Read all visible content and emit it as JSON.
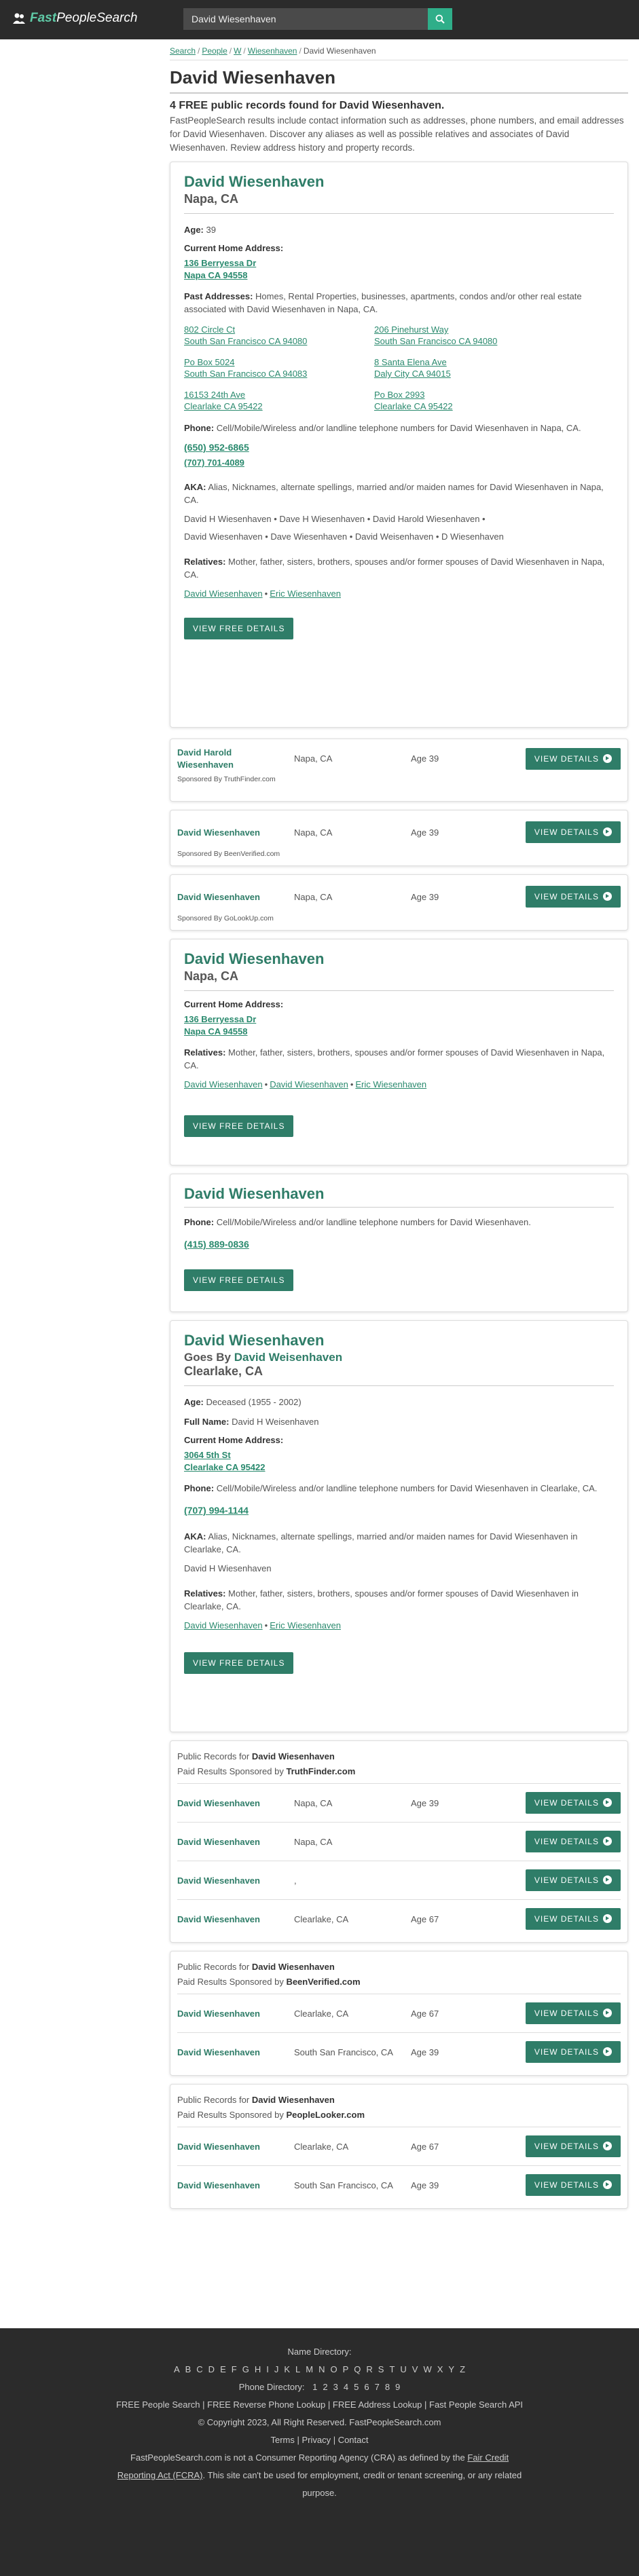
{
  "header": {
    "logo_fast": "Fast",
    "logo_rest": "PeopleSearch",
    "search_value": "David Wiesenhaven"
  },
  "breadcrumb": {
    "search": "Search",
    "people": "People",
    "w": "W",
    "wiesenhaven": "Wiesenhaven",
    "current": "David Wiesenhaven",
    "sep": "/"
  },
  "page": {
    "title": "David Wiesenhaven",
    "found": "4 FREE public records found for David Wiesenhaven.",
    "intro": "FastPeopleSearch results include contact information such as addresses, phone numbers, and email addresses for David Wiesenhaven. Discover any aliases as well as possible relatives and associates of David Wiesenhaven. Review address history and property records."
  },
  "labels": {
    "age": "Age:",
    "current_home": "Current Home Address:",
    "past_addresses": "Past Addresses:",
    "phone": "Phone:",
    "aka": "AKA:",
    "relatives": "Relatives:",
    "full_name": "Full Name:",
    "view_free_details": "VIEW FREE DETAILS",
    "view_details": "VIEW DETAILS",
    "goes_by": "Goes By",
    "bullet": "•"
  },
  "record1": {
    "name": "David Wiesenhaven",
    "location": "Napa, CA",
    "age": "39",
    "current_line1": "136 Berryessa Dr",
    "current_line2": "Napa CA 94558",
    "past_desc": "Homes, Rental Properties, businesses, apartments, condos and/or other real estate associated with David Wiesenhaven in Napa, CA.",
    "past": [
      {
        "l1": "802 Circle Ct",
        "l2": "South San Francisco CA 94080"
      },
      {
        "l1": "206 Pinehurst Way",
        "l2": "South San Francisco CA 94080"
      },
      {
        "l1": "Po Box 5024",
        "l2": "South San Francisco CA 94083"
      },
      {
        "l1": "8 Santa Elena Ave",
        "l2": "Daly City CA 94015"
      },
      {
        "l1": "16153 24th Ave",
        "l2": "Clearlake CA 95422"
      },
      {
        "l1": "Po Box 2993",
        "l2": "Clearlake CA 95422"
      }
    ],
    "phone_desc": "Cell/Mobile/Wireless and/or landline telephone numbers for David Wiesenhaven in Napa, CA.",
    "phones": [
      "(650) 952-6865",
      "(707) 701-4089"
    ],
    "aka_desc": "Alias, Nicknames, alternate spellings, married and/or maiden names for David Wiesenhaven in Napa, CA.",
    "aka_line1": "David H Wiesenhaven • Dave H Wiesenhaven • David Harold Wiesenhaven •",
    "aka_line2": "David Wiesenhaven • Dave Wiesenhaven • David Weisenhaven • D Wiesenhaven",
    "rel_desc": "Mother, father, sisters, brothers, spouses and/or former spouses of David Wiesenhaven in Napa, CA.",
    "relatives": [
      "David Wiesenhaven",
      "Eric Wiesenhaven"
    ]
  },
  "sponsored": [
    {
      "name_l1": "David Harold",
      "name_l2": "Wiesenhaven",
      "loc": "Napa, CA",
      "age": "Age 39",
      "by": "Sponsored By TruthFinder.com"
    },
    {
      "name_l1": "David Wiesenhaven",
      "name_l2": "",
      "loc": "Napa, CA",
      "age": "Age 39",
      "by": "Sponsored By BeenVerified.com"
    },
    {
      "name_l1": "David Wiesenhaven",
      "name_l2": "",
      "loc": "Napa, CA",
      "age": "Age 39",
      "by": "Sponsored By GoLookUp.com"
    }
  ],
  "record2": {
    "name": "David Wiesenhaven",
    "location": "Napa, CA",
    "current_line1": "136 Berryessa Dr",
    "current_line2": "Napa CA 94558",
    "rel_desc": "Mother, father, sisters, brothers, spouses and/or former spouses of David Wiesenhaven in Napa, CA.",
    "relatives": [
      "David Wiesenhaven",
      "David Wiesenhaven",
      "Eric Wiesenhaven"
    ]
  },
  "record3": {
    "name": "David Wiesenhaven",
    "phone_desc": "Cell/Mobile/Wireless and/or landline telephone numbers for David Wiesenhaven.",
    "phone": "(415) 889-0836"
  },
  "record4": {
    "name": "David Wiesenhaven",
    "goes_by_name": "David Weisenhaven",
    "location": "Clearlake, CA",
    "age": "Deceased (1955 - 2002)",
    "full_name": "David H Weisenhaven",
    "current_line1": "3064 5th St",
    "current_line2": "Clearlake CA 95422",
    "phone_desc": "Cell/Mobile/Wireless and/or landline telephone numbers for David Wiesenhaven in Clearlake, CA.",
    "phone": "(707) 994-1144",
    "aka_desc": "Alias, Nicknames, alternate spellings, married and/or maiden names for David Wiesenhaven in Clearlake, CA.",
    "aka_line1": "David H Wiesenhaven",
    "rel_desc": "Mother, father, sisters, brothers, spouses and/or former spouses of David Wiesenhaven in Clearlake, CA.",
    "relatives": [
      "David Wiesenhaven",
      "Eric Wiesenhaven"
    ]
  },
  "public_records": [
    {
      "head1_prefix": "Public Records for",
      "head1_name": "David Wiesenhaven",
      "head2_prefix": "Paid Results Sponsored by",
      "head2_sponsor": "TruthFinder.com",
      "rows": [
        {
          "name": "David Wiesenhaven",
          "loc": "Napa, CA",
          "age": "Age 39"
        },
        {
          "name": "David Wiesenhaven",
          "loc": "Napa, CA",
          "age": ""
        },
        {
          "name": "David Wiesenhaven",
          "loc": ",",
          "age": ""
        },
        {
          "name": "David Wiesenhaven",
          "loc": "Clearlake, CA",
          "age": "Age 67"
        }
      ]
    },
    {
      "head1_prefix": "Public Records for",
      "head1_name": "David Wiesenhaven",
      "head2_prefix": "Paid Results Sponsored by",
      "head2_sponsor": "BeenVerified.com",
      "rows": [
        {
          "name": "David Wiesenhaven",
          "loc": "Clearlake, CA",
          "age": "Age 67"
        },
        {
          "name": "David Wiesenhaven",
          "loc": "South San Francisco, CA",
          "age": "Age 39"
        }
      ]
    },
    {
      "head1_prefix": "Public Records for",
      "head1_name": "David Wiesenhaven",
      "head2_prefix": "Paid Results Sponsored by",
      "head2_sponsor": "PeopleLooker.com",
      "rows": [
        {
          "name": "David Wiesenhaven",
          "loc": "Clearlake, CA",
          "age": "Age 67"
        },
        {
          "name": "David Wiesenhaven",
          "loc": "South San Francisco, CA",
          "age": "Age 39"
        }
      ]
    }
  ],
  "footer": {
    "name_directory": "Name Directory:",
    "letters": [
      "A",
      "B",
      "C",
      "D",
      "E",
      "F",
      "G",
      "H",
      "I",
      "J",
      "K",
      "L",
      "M",
      "N",
      "O",
      "P",
      "Q",
      "R",
      "S",
      "T",
      "U",
      "V",
      "W",
      "X",
      "Y",
      "Z"
    ],
    "phone_directory": "Phone Directory:",
    "digits": [
      "1",
      "2",
      "3",
      "4",
      "5",
      "6",
      "7",
      "8",
      "9"
    ],
    "links_line": "FREE People Search | FREE Reverse Phone Lookup | FREE Address Lookup | Fast People Search API",
    "copyright": "© Copyright 2023, All Right Reserved. FastPeopleSearch.com",
    "policy_line": "Terms | Privacy | Contact",
    "disclaimer_a": "FastPeopleSearch.com is not a Consumer Reporting Agency (CRA) as defined by the",
    "fcra_link_a": "Fair Credit",
    "fcra_link_b": "Reporting Act (FCRA)",
    "disclaimer_b": ". This site can't be used for employment, credit or tenant screening, or any related",
    "disclaimer_c": "purpose."
  }
}
